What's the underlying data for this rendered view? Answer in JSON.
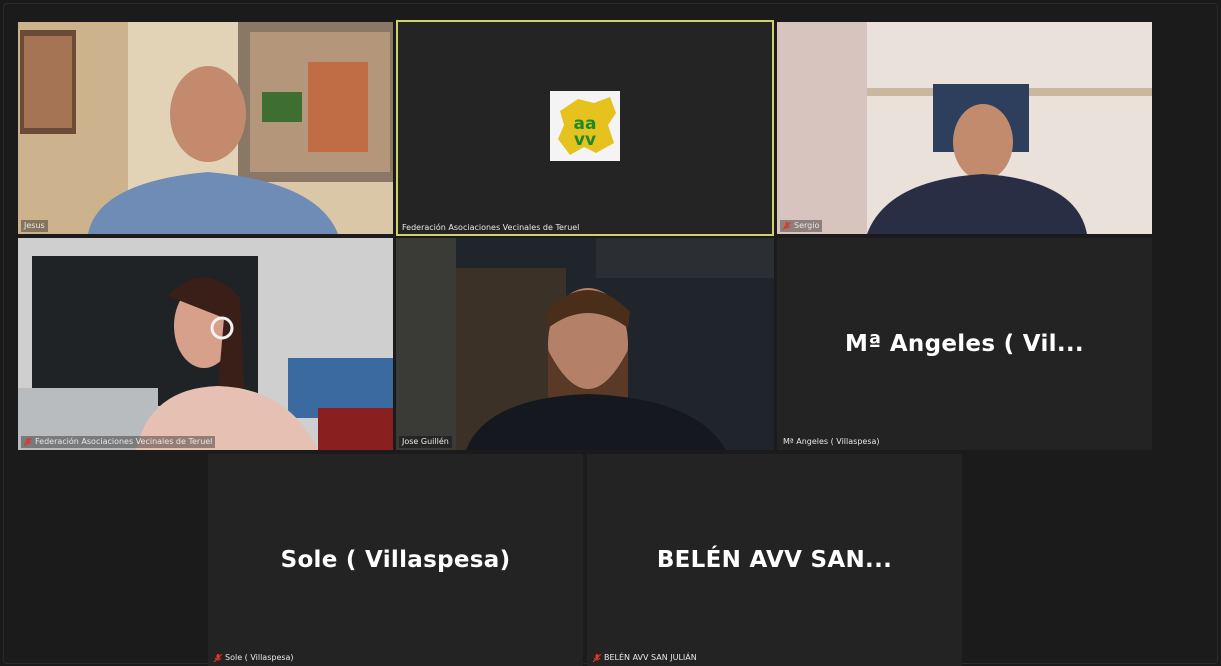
{
  "participants": [
    {
      "name": "Jesus",
      "type": "video",
      "muted": false
    },
    {
      "name": "Federación Asociaciones Vecinales de Teruel",
      "type": "logo",
      "muted": false,
      "active_speaker": true
    },
    {
      "name": "Sergio",
      "type": "video",
      "muted": true
    },
    {
      "name": "Federación Asociaciones Vecinales de Teruel",
      "type": "video",
      "muted": true
    },
    {
      "name": "Jose Guillén",
      "type": "video",
      "muted": false
    },
    {
      "name": "Mª Angeles ( Villaspesa)",
      "display_name": "Mª Angeles ( Vil...",
      "type": "name-only",
      "muted": false
    },
    {
      "name": "Sole ( Villaspesa)",
      "display_name": "Sole ( Villaspesa)",
      "type": "name-only",
      "muted": true
    },
    {
      "name": "BELÉN AVV SAN JULIÁN",
      "display_name": "BELÉN AVV SAN...",
      "type": "name-only",
      "muted": true
    }
  ],
  "logo": {
    "text": "aavv",
    "colors": {
      "map": "#e6c21e",
      "letters": "#1a8a2a"
    }
  },
  "colors": {
    "active_border": "#cfd36a",
    "muted_icon": "#e0362c",
    "tile_bg": "#232323"
  }
}
